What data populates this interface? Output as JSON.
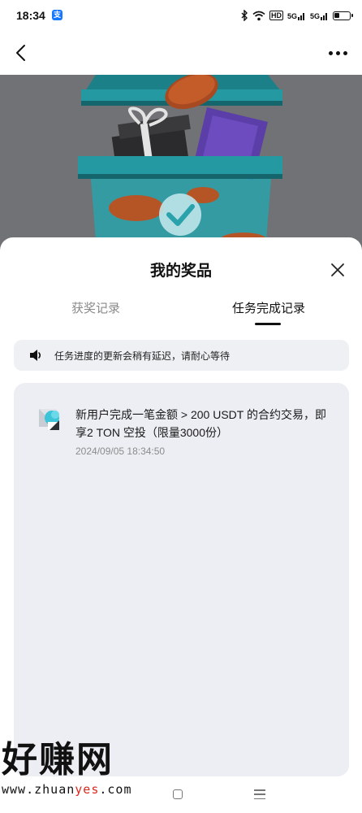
{
  "status_bar": {
    "time": "18:34",
    "app_badge": "支",
    "network_labels": [
      "HD",
      "5G",
      "5G"
    ]
  },
  "nav": {
    "back_icon": "chevron-left-icon",
    "more_icon": "more-dots-icon"
  },
  "sheet": {
    "title": "我的奖品",
    "tabs": [
      {
        "label": "获奖记录",
        "active": false
      },
      {
        "label": "任务完成记录",
        "active": true
      }
    ],
    "notice": {
      "icon": "speaker-icon",
      "text": "任务进度的更新会稍有延迟，请耐心等待"
    },
    "records": [
      {
        "title": "新用户完成一笔金额 > 200 USDT 的合约交易，即享2 TON 空投（限量3000份）",
        "time": "2024/09/05 18:34:50"
      }
    ]
  },
  "watermark": {
    "brand": "好赚网",
    "url_prefix": "www.zhuan",
    "url_highlight": "yes",
    "url_suffix": ".com"
  },
  "colors": {
    "hero_bg": "#717275",
    "chest_teal": "#1f8a92",
    "card_bg": "#eceef3",
    "notice_bg": "#eef0f3",
    "watermark_red": "#d9281e"
  }
}
